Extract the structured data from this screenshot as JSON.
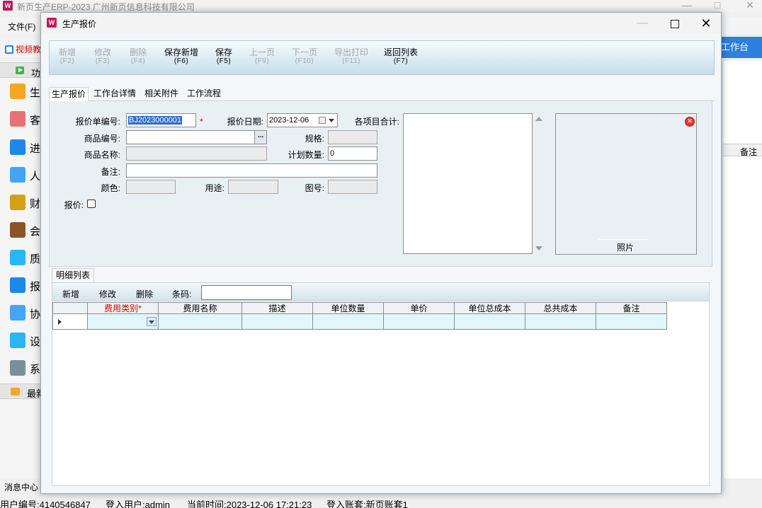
{
  "main_window": {
    "title": "新页生产ERP-2023 广州新页信息科技有限公司",
    "logo_text": "W",
    "menu_file": "文件(F)",
    "video_link": "视频教",
    "workbench_button": "工作台",
    "right_column_header": "备注",
    "message_center": "消息中心"
  },
  "left_nav": {
    "header_label": "功",
    "items": [
      {
        "label": "生",
        "icon": "folder-icon",
        "color": "#f5a623"
      },
      {
        "label": "客",
        "icon": "customer-icon",
        "color": "#e57373"
      },
      {
        "label": "进",
        "icon": "bar-chart-icon",
        "color": "#1e88e5"
      },
      {
        "label": "人",
        "icon": "person-icon",
        "color": "#42a5f5"
      },
      {
        "label": "财",
        "icon": "coins-icon",
        "color": "#d4a017"
      },
      {
        "label": "会",
        "icon": "book-icon",
        "color": "#8d5524"
      },
      {
        "label": "质",
        "icon": "tiles-icon",
        "color": "#29b6f6"
      },
      {
        "label": "报",
        "icon": "report-icon",
        "color": "#1e88e5"
      },
      {
        "label": "协",
        "icon": "calendar-icon",
        "color": "#42a5f5"
      },
      {
        "label": "设",
        "icon": "settings-tiles-icon",
        "color": "#29b6f6"
      },
      {
        "label": "系",
        "icon": "lock-icon",
        "color": "#78909c"
      }
    ],
    "footer_label": "最新"
  },
  "status_bar": {
    "user_id": "用户编号:4140546847",
    "login_user": "登入用户:admin",
    "current_time": "当前时间:2023-12-06 17:21:23",
    "account_set": "登入账套:新页账套1"
  },
  "dialog": {
    "title": "生产报价",
    "logo_text": "W",
    "minimize": "—",
    "close": "✕",
    "toolbar": [
      {
        "label": "新增",
        "key": "(F2)",
        "enabled": false
      },
      {
        "label": "修改",
        "key": "(F3)",
        "enabled": false
      },
      {
        "label": "删除",
        "key": "(F4)",
        "enabled": false
      },
      {
        "label": "保存新增",
        "key": "(F6)",
        "enabled": true
      },
      {
        "label": "保存",
        "key": "(F5)",
        "enabled": true
      },
      {
        "label": "上一页",
        "key": "(F9)",
        "enabled": false
      },
      {
        "label": "下一页",
        "key": "(F10)",
        "enabled": false
      },
      {
        "label": "导出打印",
        "key": "(F11)",
        "enabled": false
      },
      {
        "label": "返回列表",
        "key": "(F7)",
        "enabled": true
      }
    ],
    "tabs": [
      "生产报价",
      "工作台详情",
      "相关附件",
      "工作流程"
    ],
    "active_tab": "生产报价",
    "form": {
      "quote_no_label": "报价单编号:",
      "quote_no_value": "BJ2023000001",
      "required_mark": "*",
      "quote_date_label": "报价日期:",
      "quote_date_value": "2023-12-06",
      "totals_label": "各项目合计:",
      "product_code_label": "商品编号:",
      "product_code_value": "",
      "ellipsis_label": "...",
      "spec_label": "规格:",
      "spec_value": "",
      "product_name_label": "商品名称:",
      "product_name_value": "",
      "plan_qty_label": "计划数量:",
      "plan_qty_value": "0",
      "remark_label": "备注:",
      "remark_value": "",
      "color_label": "颜色:",
      "color_value": "",
      "usage_label": "用途:",
      "usage_value": "",
      "drawing_no_label": "图号:",
      "drawing_no_value": "",
      "quoted_label": "报价:",
      "quoted_checked": false,
      "photo_label": "照片",
      "photo_close": "×"
    },
    "detail": {
      "tab_label": "明细列表",
      "buttons": [
        "新增",
        "修改",
        "删除"
      ],
      "barcode_label": "条码:",
      "barcode_value": "",
      "columns": [
        "费用类别*",
        "费用名称",
        "描述",
        "单位数量",
        "单价",
        "单位总成本",
        "总共成本",
        "备注"
      ],
      "required_column": "费用类别*"
    }
  }
}
